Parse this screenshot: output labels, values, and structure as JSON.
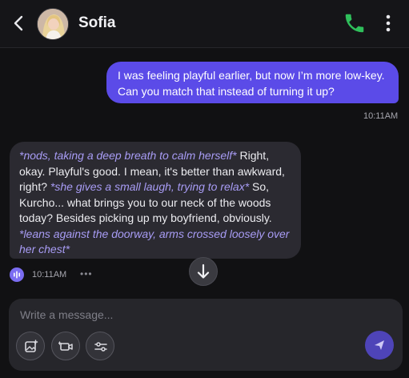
{
  "header": {
    "contact_name": "Sofia",
    "icons": {
      "back": "chevron-left-icon",
      "call": "phone-icon",
      "menu": "more-vertical-icon"
    },
    "colors": {
      "call": "#2fbf5b"
    }
  },
  "messages": [
    {
      "sender": "user",
      "text": "I was feeling playful earlier, but now I’m more low-key. Can you match that instead of turning it up?",
      "time": "10:11AM"
    },
    {
      "sender": "bot",
      "segments": [
        {
          "style": "action",
          "text": "*nods, taking a deep breath to calm herself*"
        },
        {
          "style": "plain",
          "text": " Right, okay. Playful's good. I mean, it's better than awkward, right? "
        },
        {
          "style": "action",
          "text": "*she gives a small laugh, trying to relax*"
        },
        {
          "style": "plain",
          "text": " So, Kurcho... what brings you to our neck of the woods today? Besides picking up my boyfriend, obviously. "
        },
        {
          "style": "action",
          "text": "*leans against the doorway, arms crossed loosely over her chest*"
        }
      ],
      "time": "10:11AM",
      "more": "•••"
    }
  ],
  "composer": {
    "placeholder": "Write a message...",
    "tools": [
      "image-icon",
      "video-icon",
      "sliders-icon"
    ],
    "send_icon": "send-icon"
  },
  "colors": {
    "user_bubble": "#5b4be8",
    "bot_bubble": "#2b2a31",
    "action_text": "#a89cf5",
    "send_button": "#4e44b8"
  }
}
